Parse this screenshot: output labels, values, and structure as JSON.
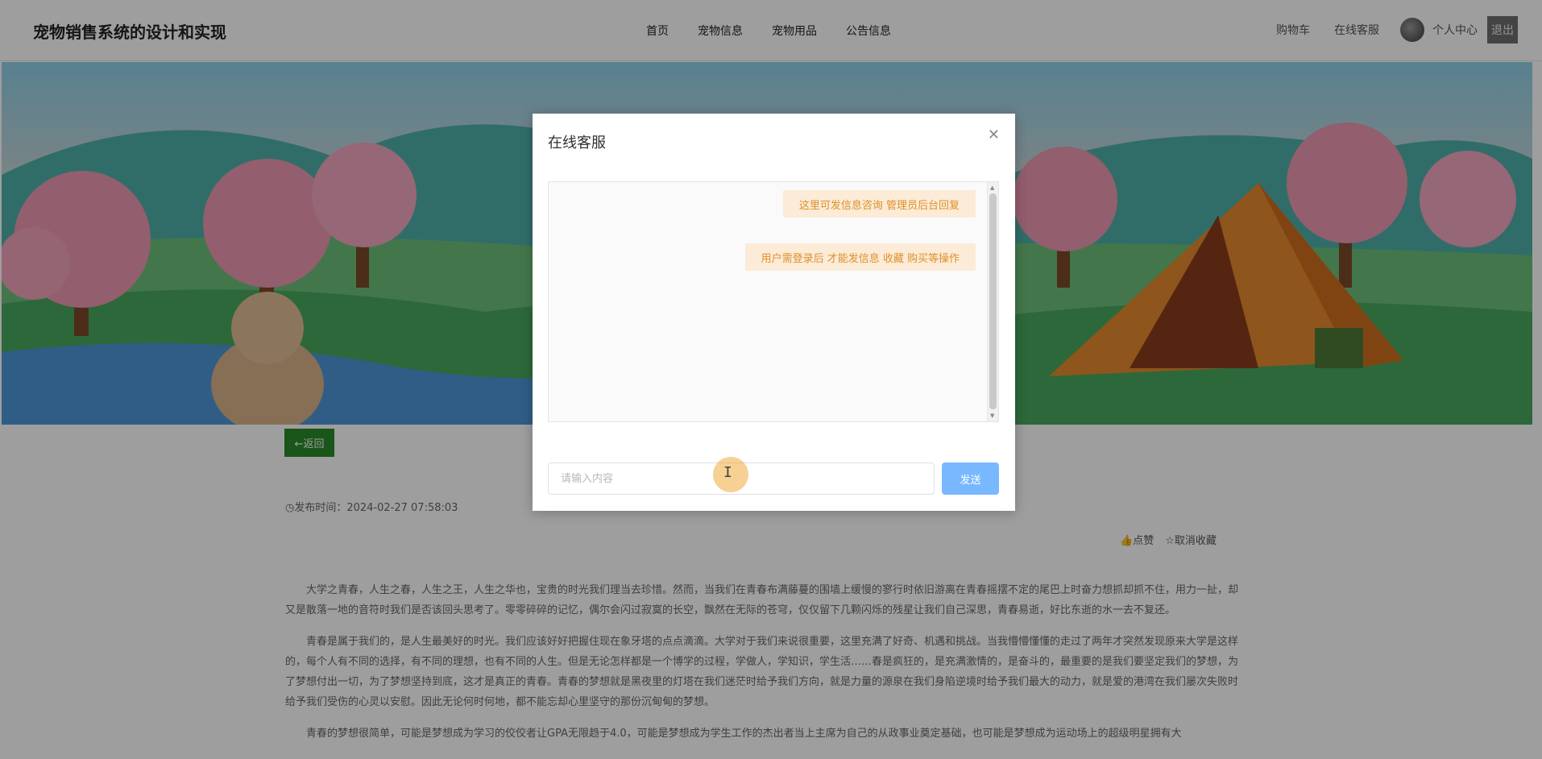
{
  "header": {
    "site_title": "宠物销售系统的设计和实现",
    "nav": [
      "首页",
      "宠物信息",
      "宠物用品",
      "公告信息"
    ],
    "right": {
      "cart": "购物车",
      "support": "在线客服",
      "profile": "个人中心",
      "logout": "退出"
    }
  },
  "content": {
    "back_label": "←返回",
    "publish_time": "发布时间：2024-02-27 07:58:03",
    "like_label": "点赞",
    "unfavorite_label": "取消收藏",
    "paragraphs": [
      "大学之青春，人生之春，人生之王，人生之华也，宝贵的时光我们理当去珍惜。然而，当我们在青春布满藤蔓的围墙上缓慢的寥行时依旧游离在青春摇摆不定的尾巴上时奋力想抓却抓不住，用力一扯，却又是散落一地的音符时我们是否该回头思考了。零零碎碎的记忆，偶尔会闪过寂寞的长空，飘然在无际的苍穹，仅仅留下几颗闪烁的残星让我们自己深思，青春易逝，好比东逝的水一去不复还。",
      "青春是属于我们的，是人生最美好的时光。我们应该好好把握住现在象牙塔的点点滴滴。大学对于我们来说很重要，这里充满了好奇、机遇和挑战。当我懵懵懂懂的走过了两年才突然发现原来大学是这样的，每个人有不同的选择，有不同的理想，也有不同的人生。但是无论怎样都是一个博学的过程，学做人，学知识，学生活……春是疯狂的，是充满激情的，是奋斗的，最重要的是我们要坚定我们的梦想，为了梦想付出一切，为了梦想坚持到底，这才是真正的青春。青春的梦想就是黑夜里的灯塔在我们迷茫时给予我们方向，就是力量的源泉在我们身陷逆境时给予我们最大的动力，就是爱的港湾在我们屡次失败时给予我们受伤的心灵以安慰。因此无论何时何地，都不能忘却心里坚守的那份沉甸甸的梦想。",
      "青春的梦想很简单，可能是梦想成为学习的佼佼者让GPA无限趋于4.0，可能是梦想成为学生工作的杰出者当上主席为自己的从政事业奠定基础，也可能是梦想成为运动场上的超级明星拥有大"
    ]
  },
  "modal": {
    "title": "在线客服",
    "messages": [
      "这里可发信息咨询 管理员后台回复",
      "用户需登录后 才能发信息 收藏 购买等操作"
    ],
    "input_placeholder": "请输入内容",
    "send_label": "发送"
  }
}
